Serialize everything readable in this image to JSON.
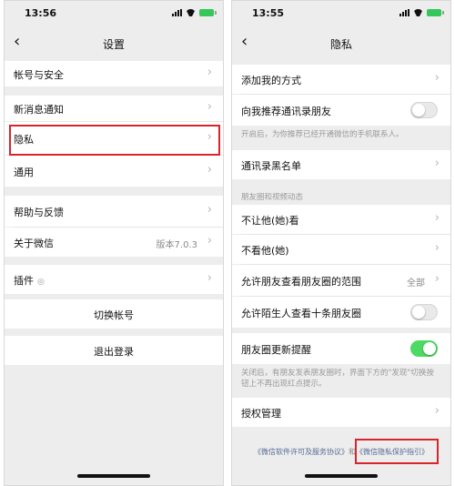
{
  "left_screen": {
    "status_time": "13:56",
    "back_icon": "‹",
    "title": "设置",
    "items": [
      {
        "label": "帐号与安全"
      },
      {
        "label": "新消息通知"
      },
      {
        "label": "隐私"
      },
      {
        "label": "通用"
      },
      {
        "label": "帮助与反馈"
      },
      {
        "label": "关于微信",
        "value": "版本7.0.3"
      },
      {
        "label": "插件",
        "icon": "plugin-icon"
      }
    ],
    "switch_account": "切换帐号",
    "logout": "退出登录",
    "chevron": "›"
  },
  "right_screen": {
    "status_time": "13:55",
    "back_icon": "‹",
    "title": "隐私",
    "add_me": "添加我的方式",
    "recommend_contacts": "向我推荐通讯录朋友",
    "recommend_hint": "开启后，为你推荐已经开通微信的手机联系人。",
    "blacklist": "通讯录黑名单",
    "moments_header": "朋友圈和视频动态",
    "dont_let_see": "不让他(她)看",
    "dont_see": "不看他(她)",
    "moments_range": "允许朋友查看朋友圈的范围",
    "moments_range_value": "全部",
    "stranger_ten": "允许陌生人查看十条朋友圈",
    "moments_update": "朋友圈更新提醒",
    "moments_update_hint": "关闭后，有朋友发表朋友圈时，界面下方的\"发现\"切换按钮上不再出现红点提示。",
    "authorization": "授权管理",
    "footer_license": "《微信软件许可及服务协议》",
    "footer_and": "和",
    "footer_privacy": "《微信隐私保护指引》",
    "chevron": "›"
  },
  "colors": {
    "highlight_red": "#d9252a",
    "toggle_on": "#4cd964",
    "link_blue": "#576b95",
    "background_gray": "#ededed"
  }
}
